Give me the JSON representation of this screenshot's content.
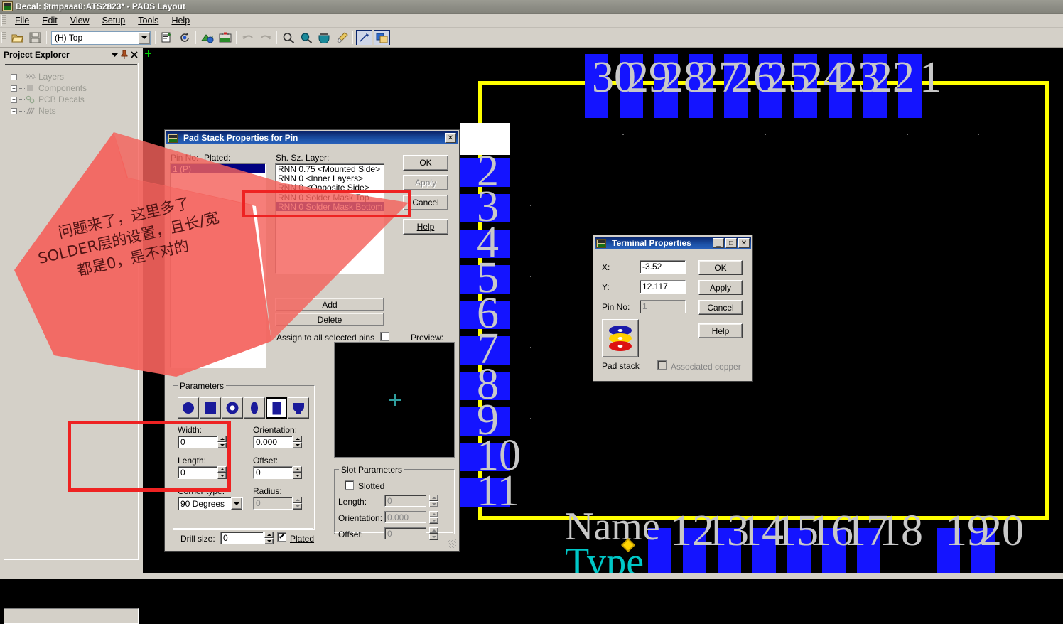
{
  "window": {
    "title": "Decal: $tmpaaa0:ATS2823* - PADS Layout",
    "app_icon": "pads-icon"
  },
  "menu": {
    "items": [
      "File",
      "Edit",
      "View",
      "Setup",
      "Tools",
      "Help"
    ]
  },
  "toolbar": {
    "layer_combo_value": "(H) Top",
    "buttons": [
      "open-icon",
      "save-icon",
      "properties-icon",
      "refresh-icon",
      "pour-icon",
      "board-icon",
      "undo-icon",
      "redo-icon",
      "zoom-icon",
      "zoom-area-icon",
      "redraw-icon",
      "brush-icon",
      "drafting-icon",
      "layers-icon"
    ]
  },
  "explorer": {
    "title": "Project Explorer",
    "header_icons": [
      "chevron-down-icon",
      "pin-icon",
      "close-icon"
    ],
    "items": [
      {
        "label": "Layers",
        "expander": "+"
      },
      {
        "label": "Components",
        "expander": "+"
      },
      {
        "label": "PCB Decals",
        "expander": "+"
      },
      {
        "label": "Nets",
        "expander": "+"
      }
    ]
  },
  "pad_stack_dialog": {
    "title": "Pad Stack Properties for Pin",
    "close_label": "✕",
    "pin_no_label": "Pin No:",
    "plated_label": "Plated:",
    "pin_list": [
      {
        "label": "1 (P)",
        "selected": true
      }
    ],
    "sh_sz_layer_label": "Sh. Sz. Layer:",
    "layers": [
      {
        "text": "RNN 0.75 <Mounted Side>",
        "selected": false
      },
      {
        "text": "RNN 0 <Inner Layers>",
        "selected": false
      },
      {
        "text": "RNN 0 <Opposite Side>",
        "selected": false
      },
      {
        "text": "RNN 0 Solder Mask Top",
        "selected": false
      },
      {
        "text": "RNN 0 Solder Mask Bottom",
        "selected": true
      }
    ],
    "buttons": {
      "ok": "OK",
      "apply": "Apply",
      "cancel": "Cancel",
      "help": "Help",
      "add": "Add",
      "delete": "Delete"
    },
    "assign_all_label": "Assign to all selected pins",
    "assign_all_checked": false,
    "preview_label": "Preview:",
    "parameters": {
      "group_title": "Parameters",
      "shapes": [
        "round-pad-icon",
        "square-pad-icon",
        "annular-pad-icon",
        "oval-pad-icon",
        "rectangle-pad-icon",
        "finger-pad-icon"
      ],
      "selected_shape_index": 4,
      "width_label": "Width:",
      "width_value": "0",
      "length_label": "Length:",
      "length_value": "0",
      "corner_type_label": "Corner type:",
      "corner_type_value": "90 Degrees",
      "orientation_label": "Orientation:",
      "orientation_value": "0.000",
      "offset_label": "Offset:",
      "offset_value": "0",
      "radius_label": "Radius:",
      "radius_value": "0",
      "radius_disabled": true
    },
    "slot_parameters": {
      "group_title": "Slot Parameters",
      "slotted_label": "Slotted",
      "slotted_checked": false,
      "length_label": "Length:",
      "length_value": "0",
      "orientation_label": "Orientation:",
      "orientation_value": "0.000",
      "offset_label": "Offset:",
      "offset_value": "0"
    },
    "drill_size_label": "Drill size:",
    "drill_size_value": "0",
    "plated_checkbox_label": "Plated",
    "plated_checked": true
  },
  "terminal_dialog": {
    "title": "Terminal Properties",
    "minimize_label": "_",
    "maximize_label": "□",
    "close_label": "✕",
    "x_label": "X:",
    "x_value": "-3.52",
    "y_label": "Y:",
    "y_value": "12.117",
    "pin_no_label": "Pin No:",
    "pin_no_value": "1",
    "buttons": {
      "ok": "OK",
      "apply": "Apply",
      "cancel": "Cancel",
      "help": "Help"
    },
    "pad_stack_label": "Pad stack",
    "pad_stack_icon": "padstack-icon",
    "associated_copper_label": "Associated copper",
    "associated_copper_checked": false
  },
  "annotation": {
    "text": "问题来了，这里多了SOLDER层的设置，且长/宽都是0，是不对的",
    "arrow_color": "#f4625c",
    "rect_color": "#ee2222"
  },
  "canvas": {
    "background": "#000000",
    "pad_color": "#1414ff",
    "outline_color": "#ffff00",
    "label_color": "#c8c8c8",
    "type_color": "#00c8c8",
    "name_text": "Name",
    "type_text": "Type",
    "top_pins": [
      "30",
      "29",
      "28",
      "27",
      "26",
      "25",
      "24",
      "23",
      "22",
      "1"
    ],
    "left_pins": [
      "2",
      "3",
      "4",
      "5",
      "6",
      "7",
      "8",
      "9",
      "10",
      "11"
    ],
    "bottom_pins": [
      "12",
      "13",
      "14",
      "15",
      "16",
      "17",
      "18"
    ],
    "bottom_right_pins": [
      "19",
      "20"
    ]
  }
}
